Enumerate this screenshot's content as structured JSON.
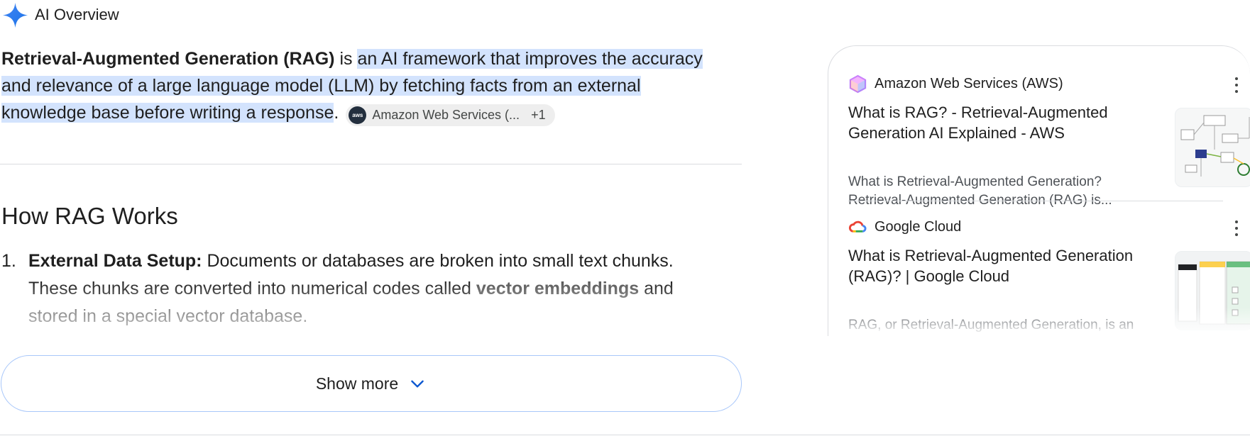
{
  "header": {
    "title": "AI Overview",
    "icon": "gemini-spark-icon"
  },
  "lead": {
    "term": "Retrieval-Augmented Generation (RAG)",
    "connector": " is ",
    "highlight": "an AI framework that improves the accuracy and relevance of a large language model (LLM) by fetching facts from an external knowledge base before writing a response",
    "end": ".",
    "chip": {
      "label": "Amazon Web Services (...",
      "extra": "+1",
      "logo_text": "aws"
    }
  },
  "section": {
    "heading": "How RAG Works"
  },
  "steps": [
    {
      "num": "1.",
      "title": "External Data Setup:",
      "text1": " Documents or databases are broken into small text chunks. These chunks are converted into numerical codes called ",
      "bold": "vector embeddings",
      "text2": " and stored in a special vector database."
    }
  ],
  "show_more": {
    "label": "Show more"
  },
  "sources": [
    {
      "name": "Amazon Web Services (AWS)",
      "icon": "aws-cube-icon",
      "title": "What is RAG? - Retrieval-Augmented Generation AI Explained - AWS",
      "snippet": "What is Retrieval-Augmented Generation? Retrieval-Augmented Generation (RAG) is..."
    },
    {
      "name": "Google Cloud",
      "icon": "google-cloud-icon",
      "title": "What is Retrieval-Augmented Generation (RAG)? | Google Cloud",
      "snippet": "RAG, or Retrieval-Augmented Generation, is an AI framework that combines traditional..."
    }
  ],
  "colors": {
    "highlight": "#d3e3fd",
    "accent": "#0b57d0",
    "border": "#a8c7fa"
  }
}
